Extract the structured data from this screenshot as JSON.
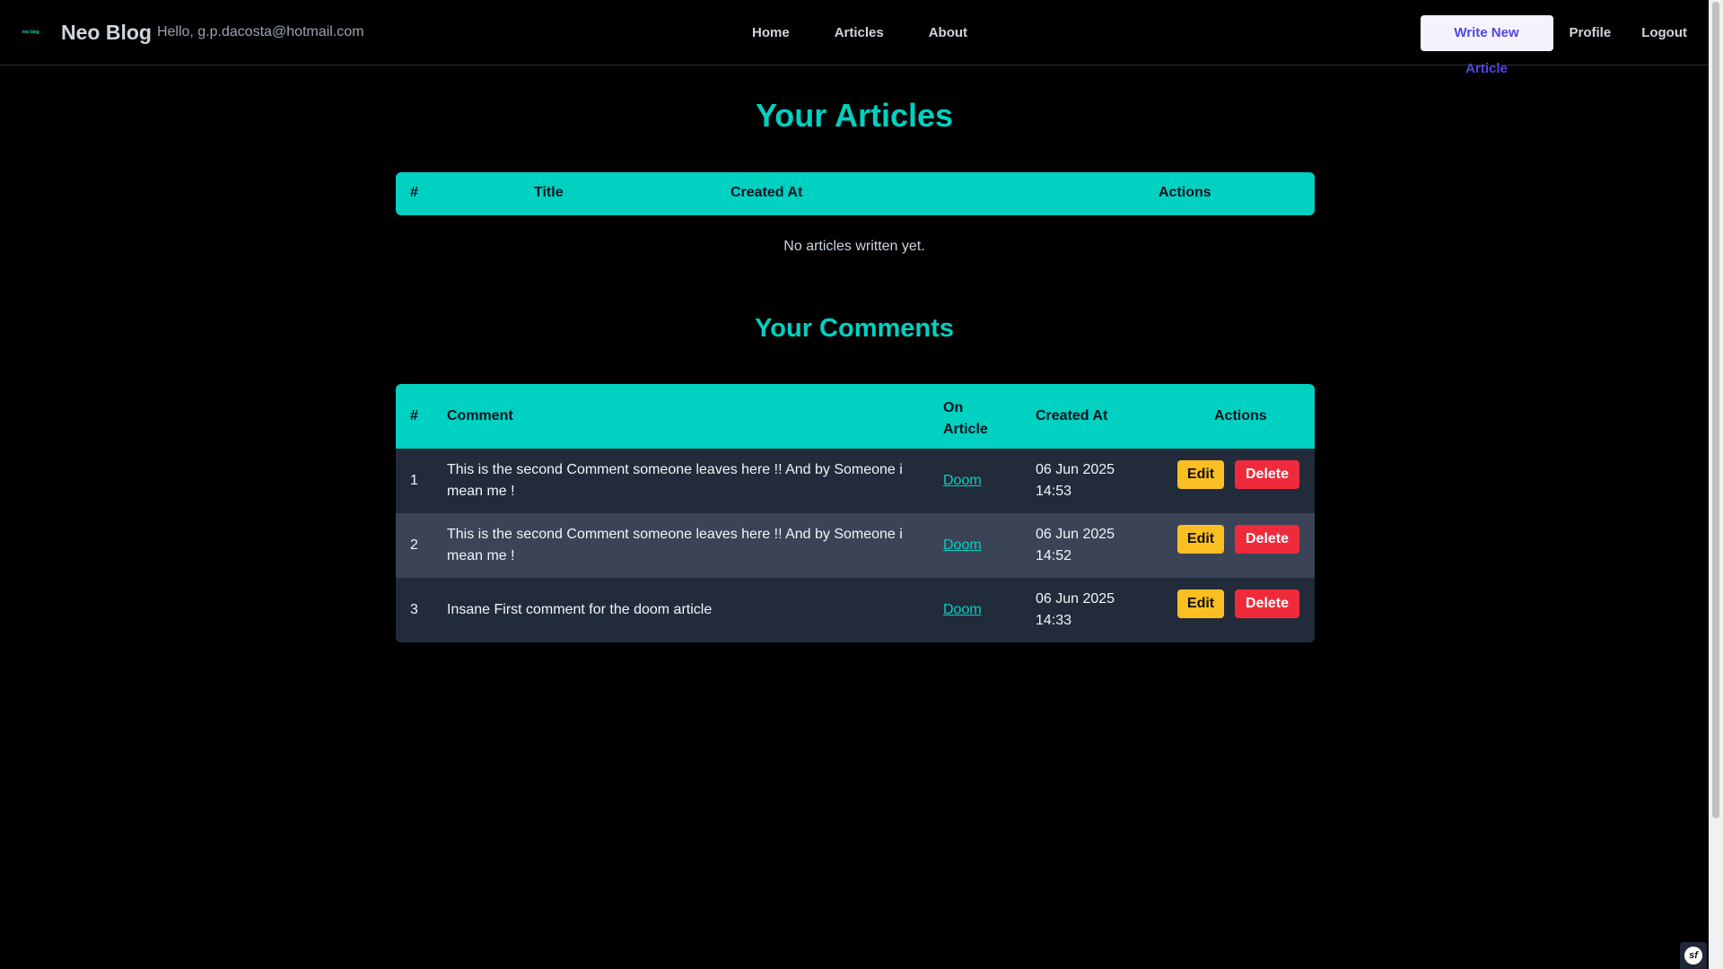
{
  "navbar": {
    "logo_text": "neo blog",
    "brand": "Neo Blog",
    "greeting": "Hello, g.p.dacosta@hotmail.com",
    "links": [
      "Home",
      "Articles",
      "About"
    ],
    "write_button": "Write New Article",
    "profile": "Profile",
    "logout": "Logout"
  },
  "articles": {
    "title": "Your Articles",
    "columns": [
      "#",
      "Title",
      "Created At",
      "Actions"
    ],
    "empty_message": "No articles written yet."
  },
  "comments": {
    "title": "Your Comments",
    "columns": [
      "#",
      "Comment",
      "On Article",
      "Created At",
      "Actions"
    ],
    "rows": [
      {
        "index": "1",
        "comment": "This is the second Comment someone leaves here !! And by Someone i mean me !",
        "article": "Doom",
        "created_at": "06 Jun 2025 14:53",
        "edit": "Edit",
        "delete": "Delete"
      },
      {
        "index": "2",
        "comment": "This is the second Comment someone leaves here !! And by Someone i mean me !",
        "article": "Doom",
        "created_at": "06 Jun 2025 14:52",
        "edit": "Edit",
        "delete": "Delete"
      },
      {
        "index": "3",
        "comment": "Insane First comment for the doom article",
        "article": "Doom",
        "created_at": "06 Jun 2025 14:33",
        "edit": "Edit",
        "delete": "Delete"
      }
    ]
  },
  "colors": {
    "accent": "#00d1c1",
    "background": "#000000",
    "edit": "#fbbf24",
    "delete": "#ef2b3b"
  }
}
